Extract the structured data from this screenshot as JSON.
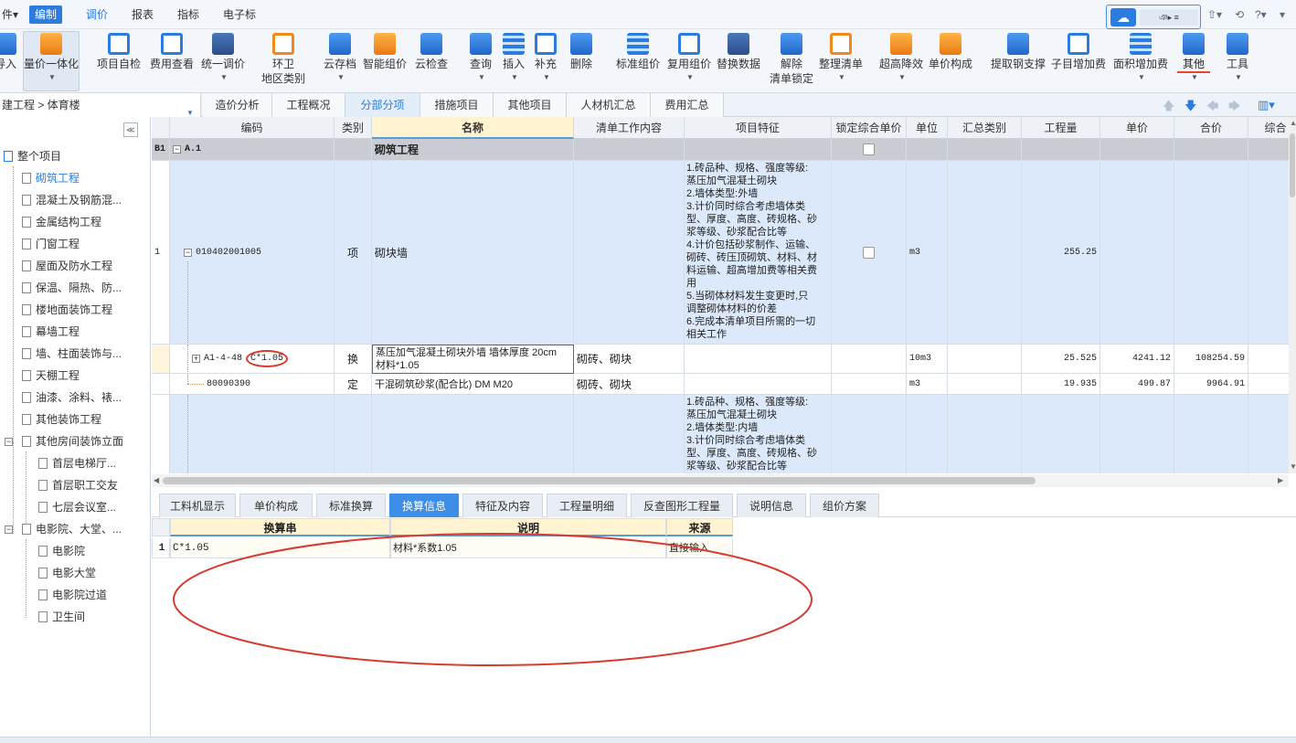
{
  "menu": {
    "items": [
      "件▾",
      "编制",
      "调价",
      "报表",
      "指标",
      "电子标"
    ],
    "active_index": 1,
    "cloud_text": "ঞ▸ ≡",
    "right_icons": [
      "⇧▾",
      "⟲",
      "?▾",
      "▾"
    ]
  },
  "ribbon": {
    "buttons": [
      {
        "label": "导入",
        "label2": ""
      },
      {
        "label": "量价一体化",
        "label2": "",
        "caret": true
      },
      {
        "label": "项目自检",
        "label2": ""
      },
      {
        "label": "费用查看",
        "label2": ""
      },
      {
        "label": "统一调价",
        "label2": "",
        "caret": true
      },
      {
        "label": "环卫",
        "label2": "地区类别"
      },
      {
        "label": "云存档",
        "label2": "",
        "caret": true
      },
      {
        "label": "智能组价",
        "label2": ""
      },
      {
        "label": "云检查",
        "label2": ""
      },
      {
        "label": "查询",
        "label2": "",
        "caret": true
      },
      {
        "label": "插入",
        "label2": "",
        "caret": true
      },
      {
        "label": "补充",
        "label2": "",
        "caret": true
      },
      {
        "label": "删除",
        "label2": ""
      },
      {
        "label": "标准组价",
        "label2": ""
      },
      {
        "label": "复用组价",
        "label2": "",
        "caret": true
      },
      {
        "label": "替换数据",
        "label2": ""
      },
      {
        "label": "解除",
        "label2": "清单锁定"
      },
      {
        "label": "整理清单",
        "label2": "",
        "caret": true
      },
      {
        "label": "超高降效",
        "label2": "",
        "caret": true
      },
      {
        "label": "单价构成",
        "label2": ""
      },
      {
        "label": "提取钢支撑",
        "label2": ""
      },
      {
        "label": "子目增加费",
        "label2": ""
      },
      {
        "label": "面积增加费",
        "label2": "",
        "caret": true
      },
      {
        "label": "其他",
        "label2": "",
        "caret": true
      },
      {
        "label": "工具",
        "label2": "",
        "caret": true
      }
    ]
  },
  "nav": {
    "breadcrumb": "建工程 > 体育楼",
    "tabs": [
      "造价分析",
      "工程概况",
      "分部分项",
      "措施项目",
      "其他项目",
      "人材机汇总",
      "费用汇总"
    ],
    "active_tab": 2
  },
  "tree": {
    "collapse": "≪",
    "nodes": [
      {
        "label": "整个项目"
      },
      {
        "label": "砌筑工程"
      },
      {
        "label": "混凝土及钢筋混..."
      },
      {
        "label": "金属结构工程"
      },
      {
        "label": "门窗工程"
      },
      {
        "label": "屋面及防水工程"
      },
      {
        "label": "保温、隔热、防..."
      },
      {
        "label": "楼地面装饰工程"
      },
      {
        "label": "幕墙工程"
      },
      {
        "label": "墙、柱面装饰与..."
      },
      {
        "label": "天棚工程"
      },
      {
        "label": "油漆、涂料、裱..."
      },
      {
        "label": "其他装饰工程"
      },
      {
        "label": "其他房间装饰立面"
      },
      {
        "label": "首层电梯厅..."
      },
      {
        "label": "首层职工交友"
      },
      {
        "label": "七层会议室..."
      },
      {
        "label": "电影院、大堂、..."
      },
      {
        "label": "电影院"
      },
      {
        "label": "电影大堂"
      },
      {
        "label": "电影院过道"
      },
      {
        "label": "卫生间"
      }
    ]
  },
  "grid": {
    "headers": [
      "编码",
      "类别",
      "名称",
      "清单工作内容",
      "项目特征",
      "锁定综合单价",
      "单位",
      "汇总类别",
      "工程量",
      "单价",
      "合价",
      "综合"
    ],
    "section_row": {
      "index": "B1",
      "toggle": "−",
      "code": "A.1",
      "name": "砌筑工程"
    },
    "rows": [
      {
        "index": "1",
        "toggle": "−",
        "code": "010402001005",
        "type": "项",
        "name": "砌块墙",
        "work": "",
        "feature": "1.砖品种、规格、强度等级:\n蒸压加气混凝土砌块\n2.墙体类型:外墙\n3.计价同时综合考虑墙体类\n型、厚度、高度、砖规格、砂\n浆等级、砂浆配合比等\n4.计价包括砂浆制作、运输、\n砌砖、砖压顶砌筑、材料、材\n料运输、超高增加费等相关费\n用\n5.当砌体材料发生变更时,只\n调整砌体材料的价差\n6.完成本清单项目所需的一切\n相关工作",
        "unit": "m3",
        "qty": "255.25",
        "price": "",
        "total": ""
      },
      {
        "index": "",
        "toggle": "+",
        "code": "A1-4-48",
        "code_suffix": "C*1.05",
        "type": "换",
        "name": "蒸压加气混凝土砌块外墙 墙体厚度 20cm\n材料*1.05",
        "work": "砌砖、砌块",
        "feature": "",
        "unit": "10m3",
        "qty": "25.525",
        "price": "4241.12",
        "total": "108254.59"
      },
      {
        "index": "",
        "toggle": "",
        "code": "80090390",
        "type": "定",
        "name": "干混砌筑砂浆(配合比) DM M20",
        "work": "砌砖、砌块",
        "feature": "",
        "unit": "m3",
        "qty": "19.935",
        "price": "499.87",
        "total": "9964.91"
      },
      {
        "index": "",
        "toggle": "",
        "code": "",
        "type": "",
        "name": "",
        "work": "",
        "feature": "1.砖品种、规格、强度等级:\n蒸压加气混凝土砌块\n2.墙体类型:内墙\n3.计价同时综合考虑墙体类\n型、厚度、高度、砖规格、砂\n浆等级、砂浆配合比等",
        "unit": "",
        "qty": "",
        "price": "",
        "total": ""
      }
    ]
  },
  "bottom": {
    "tabs": [
      "工料机显示",
      "单价构成",
      "标准换算",
      "换算信息",
      "特征及内容",
      "工程量明细",
      "反查图形工程量",
      "说明信息",
      "组价方案"
    ],
    "active_tab": 3,
    "table": {
      "headers": [
        "换算串",
        "说明",
        "来源"
      ],
      "rows": [
        {
          "index": "1",
          "conv": "C*1.05",
          "desc": "材料*系数1.05",
          "source": "直接输入"
        }
      ]
    }
  },
  "colors": {
    "accent": "#2b7cde",
    "highlight_row": "#dce9fb",
    "annotation": "#d83a2e",
    "header_highlight": "#fff3d1"
  }
}
